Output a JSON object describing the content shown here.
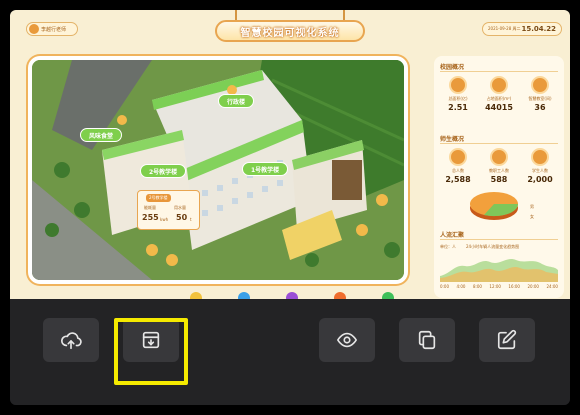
{
  "dashboard": {
    "user_chip": "李越行老师",
    "title": "智慧校园可视化系统",
    "date": "2021-09-28 周二",
    "time": "15.04.22",
    "labels": {
      "admin_building": "行政楼",
      "dining_hall": "风味食堂",
      "teaching_2": "2号教学楼",
      "teaching_1": "1号教学楼"
    },
    "popup": {
      "header": "2号教学楼",
      "stat1_label": "能耗量",
      "stat1_value": "255",
      "stat1_unit": "kwh",
      "stat2_label": "用水量",
      "stat2_value": "50",
      "stat2_unit": "t"
    },
    "panel": {
      "section1_title": "校园概况",
      "section2_title": "师生概况",
      "section3_title": "人流汇聚",
      "campus_stats": [
        {
          "label": "总面积(亿)",
          "value": "2.51"
        },
        {
          "label": "占地面积(m²)",
          "value": "44015"
        },
        {
          "label": "智慧教室(间)",
          "value": "36"
        }
      ],
      "people_stats": [
        {
          "label": "总人数",
          "value": "2,588"
        },
        {
          "label": "教职工人数",
          "value": "588"
        },
        {
          "label": "学生人数",
          "value": "2,000"
        }
      ],
      "donut_legend": [
        "男",
        "女"
      ],
      "flow_caption": "24小时车辆人流量变化趋势图",
      "flow_unit": "单位：人",
      "axis_ticks": [
        "0:00",
        "4:00",
        "8:00",
        "12:00",
        "16:00",
        "20:00",
        "24:00"
      ]
    }
  },
  "toolbar": {
    "buttons": [
      {
        "name": "upload-cloud-button",
        "icon": "cloud-upload-icon"
      },
      {
        "name": "save-to-archive-button",
        "icon": "archive-download-icon"
      },
      {
        "name": "preview-button",
        "icon": "eye-icon"
      },
      {
        "name": "copy-button",
        "icon": "copy-icon"
      },
      {
        "name": "edit-button",
        "icon": "edit-icon"
      }
    ],
    "highlight_color": "#f5ea00"
  }
}
